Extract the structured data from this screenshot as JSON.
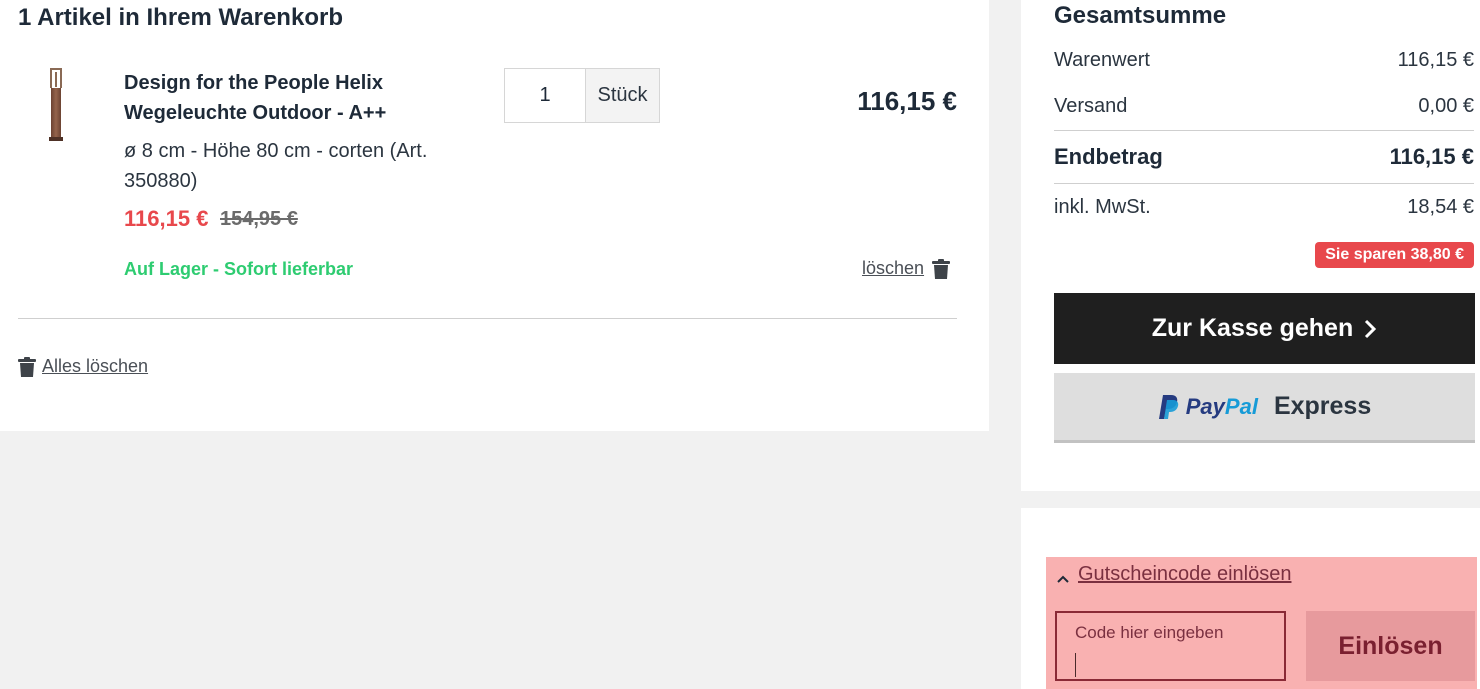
{
  "cart": {
    "title": "1 Artikel in Ihrem Warenkorb",
    "item": {
      "name": "Design for the People Helix Wegeleuchte Outdoor - A++",
      "description": "ø 8 cm - Höhe 80 cm - corten (Art. 350880)",
      "price_now": "116,15 €",
      "price_old": "154,95 €",
      "availability": "Auf Lager - Sofort lieferbar",
      "quantity": "1",
      "unit": "Stück",
      "line_total": "116,15 €",
      "delete_label": "löschen"
    },
    "clear_all_label": "Alles löschen"
  },
  "summary": {
    "title": "Gesamtsumme",
    "rows": [
      {
        "label": "Warenwert",
        "value": "116,15 €"
      },
      {
        "label": "Versand",
        "value": "0,00 €"
      },
      {
        "label": "Endbetrag",
        "value": "116,15 €"
      },
      {
        "label": "inkl. MwSt.",
        "value": "18,54 €"
      }
    ],
    "savings_badge": "Sie sparen 38,80 €",
    "checkout_label": "Zur Kasse gehen",
    "paypal": {
      "pay": "Pay",
      "pal": "Pal",
      "express": "Express"
    }
  },
  "coupon": {
    "toggle_label": "Gutscheincode einlösen",
    "input_placeholder": "Code hier eingeben",
    "redeem_label": "Einlösen"
  },
  "icons": [
    "trash-icon",
    "chevron-right-icon",
    "chevron-up-icon",
    "paypal-logo-icon"
  ],
  "colors": {
    "sale_red": "#e8484c",
    "stock_green": "#2ecc71",
    "checkout_bg": "#1f1f1f",
    "coupon_bg": "#f9b1b1"
  }
}
